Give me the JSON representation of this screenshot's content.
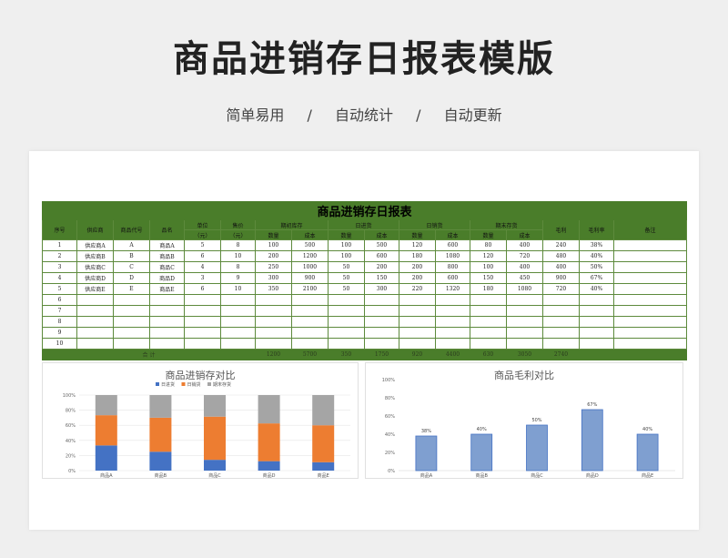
{
  "page": {
    "title": "商品进销存日报表模版",
    "features": [
      "简单易用",
      "自动统计",
      "自动更新"
    ],
    "separator": "/"
  },
  "table": {
    "title": "商品进销存日报表",
    "headers": {
      "seq": "序号",
      "supplier": "供应商",
      "code": "商品代号",
      "name": "品名",
      "unit": "单位",
      "unit_sub": "（元）",
      "price": "售价",
      "price_sub": "（元）",
      "opening": "期初库存",
      "purchase": "日进货",
      "sales": "日销货",
      "closing": "期末存货",
      "qty": "数量",
      "cost": "成本",
      "profit": "毛利",
      "margin": "毛利率",
      "remark": "备注"
    },
    "rows": [
      [
        "1",
        "供应商A",
        "A",
        "商品A",
        "5",
        "8",
        "100",
        "500",
        "100",
        "500",
        "120",
        "600",
        "80",
        "400",
        "240",
        "38%",
        ""
      ],
      [
        "2",
        "供应商B",
        "B",
        "商品B",
        "6",
        "10",
        "200",
        "1200",
        "100",
        "600",
        "180",
        "1080",
        "120",
        "720",
        "480",
        "40%",
        ""
      ],
      [
        "3",
        "供应商C",
        "C",
        "商品C",
        "4",
        "8",
        "250",
        "1000",
        "50",
        "200",
        "200",
        "800",
        "100",
        "400",
        "400",
        "50%",
        ""
      ],
      [
        "4",
        "供应商D",
        "D",
        "商品D",
        "3",
        "9",
        "300",
        "900",
        "50",
        "150",
        "200",
        "600",
        "150",
        "450",
        "900",
        "67%",
        ""
      ],
      [
        "5",
        "供应商E",
        "E",
        "商品E",
        "6",
        "10",
        "350",
        "2100",
        "50",
        "300",
        "220",
        "1320",
        "180",
        "1080",
        "720",
        "40%",
        ""
      ],
      [
        "6",
        "",
        "",
        "",
        "",
        "",
        "",
        "",
        "",
        "",
        "",
        "",
        "",
        "",
        "",
        "",
        ""
      ],
      [
        "7",
        "",
        "",
        "",
        "",
        "",
        "",
        "",
        "",
        "",
        "",
        "",
        "",
        "",
        "",
        "",
        ""
      ],
      [
        "8",
        "",
        "",
        "",
        "",
        "",
        "",
        "",
        "",
        "",
        "",
        "",
        "",
        "",
        "",
        "",
        ""
      ],
      [
        "9",
        "",
        "",
        "",
        "",
        "",
        "",
        "",
        "",
        "",
        "",
        "",
        "",
        "",
        "",
        "",
        ""
      ],
      [
        "10",
        "",
        "",
        "",
        "",
        "",
        "",
        "",
        "",
        "",
        "",
        "",
        "",
        "",
        "",
        "",
        ""
      ]
    ],
    "total_label": "合 计",
    "totals": [
      "1200",
      "5700",
      "350",
      "1750",
      "920",
      "4400",
      "630",
      "3050",
      "2740"
    ]
  },
  "chart_data": [
    {
      "type": "bar",
      "stacked": true,
      "title": "商品进销存对比",
      "categories": [
        "商品A",
        "商品B",
        "商品C",
        "商品D",
        "商品E"
      ],
      "series": [
        {
          "name": "日进货",
          "values": [
            100,
            100,
            50,
            50,
            50
          ],
          "color": "#4472c4"
        },
        {
          "name": "日销货",
          "values": [
            120,
            180,
            200,
            200,
            220
          ],
          "color": "#ed7d31"
        },
        {
          "name": "期末存货",
          "values": [
            80,
            120,
            100,
            150,
            180
          ],
          "color": "#a5a5a5"
        }
      ],
      "yticks": [
        "0%",
        "20%",
        "40%",
        "60%",
        "80%",
        "100%"
      ],
      "ylim": [
        0,
        100
      ],
      "legend": "top"
    },
    {
      "type": "bar",
      "title": "商品毛利对比",
      "categories": [
        "商品A",
        "商品B",
        "商品C",
        "商品D",
        "商品E"
      ],
      "values": [
        38,
        40,
        50,
        67,
        40
      ],
      "labels": [
        "38%",
        "40%",
        "50%",
        "67%",
        "40%"
      ],
      "color": "#4472c4",
      "yticks": [
        "0%",
        "20%",
        "40%",
        "60%",
        "80%",
        "100%"
      ],
      "ylim": [
        0,
        100
      ]
    }
  ]
}
